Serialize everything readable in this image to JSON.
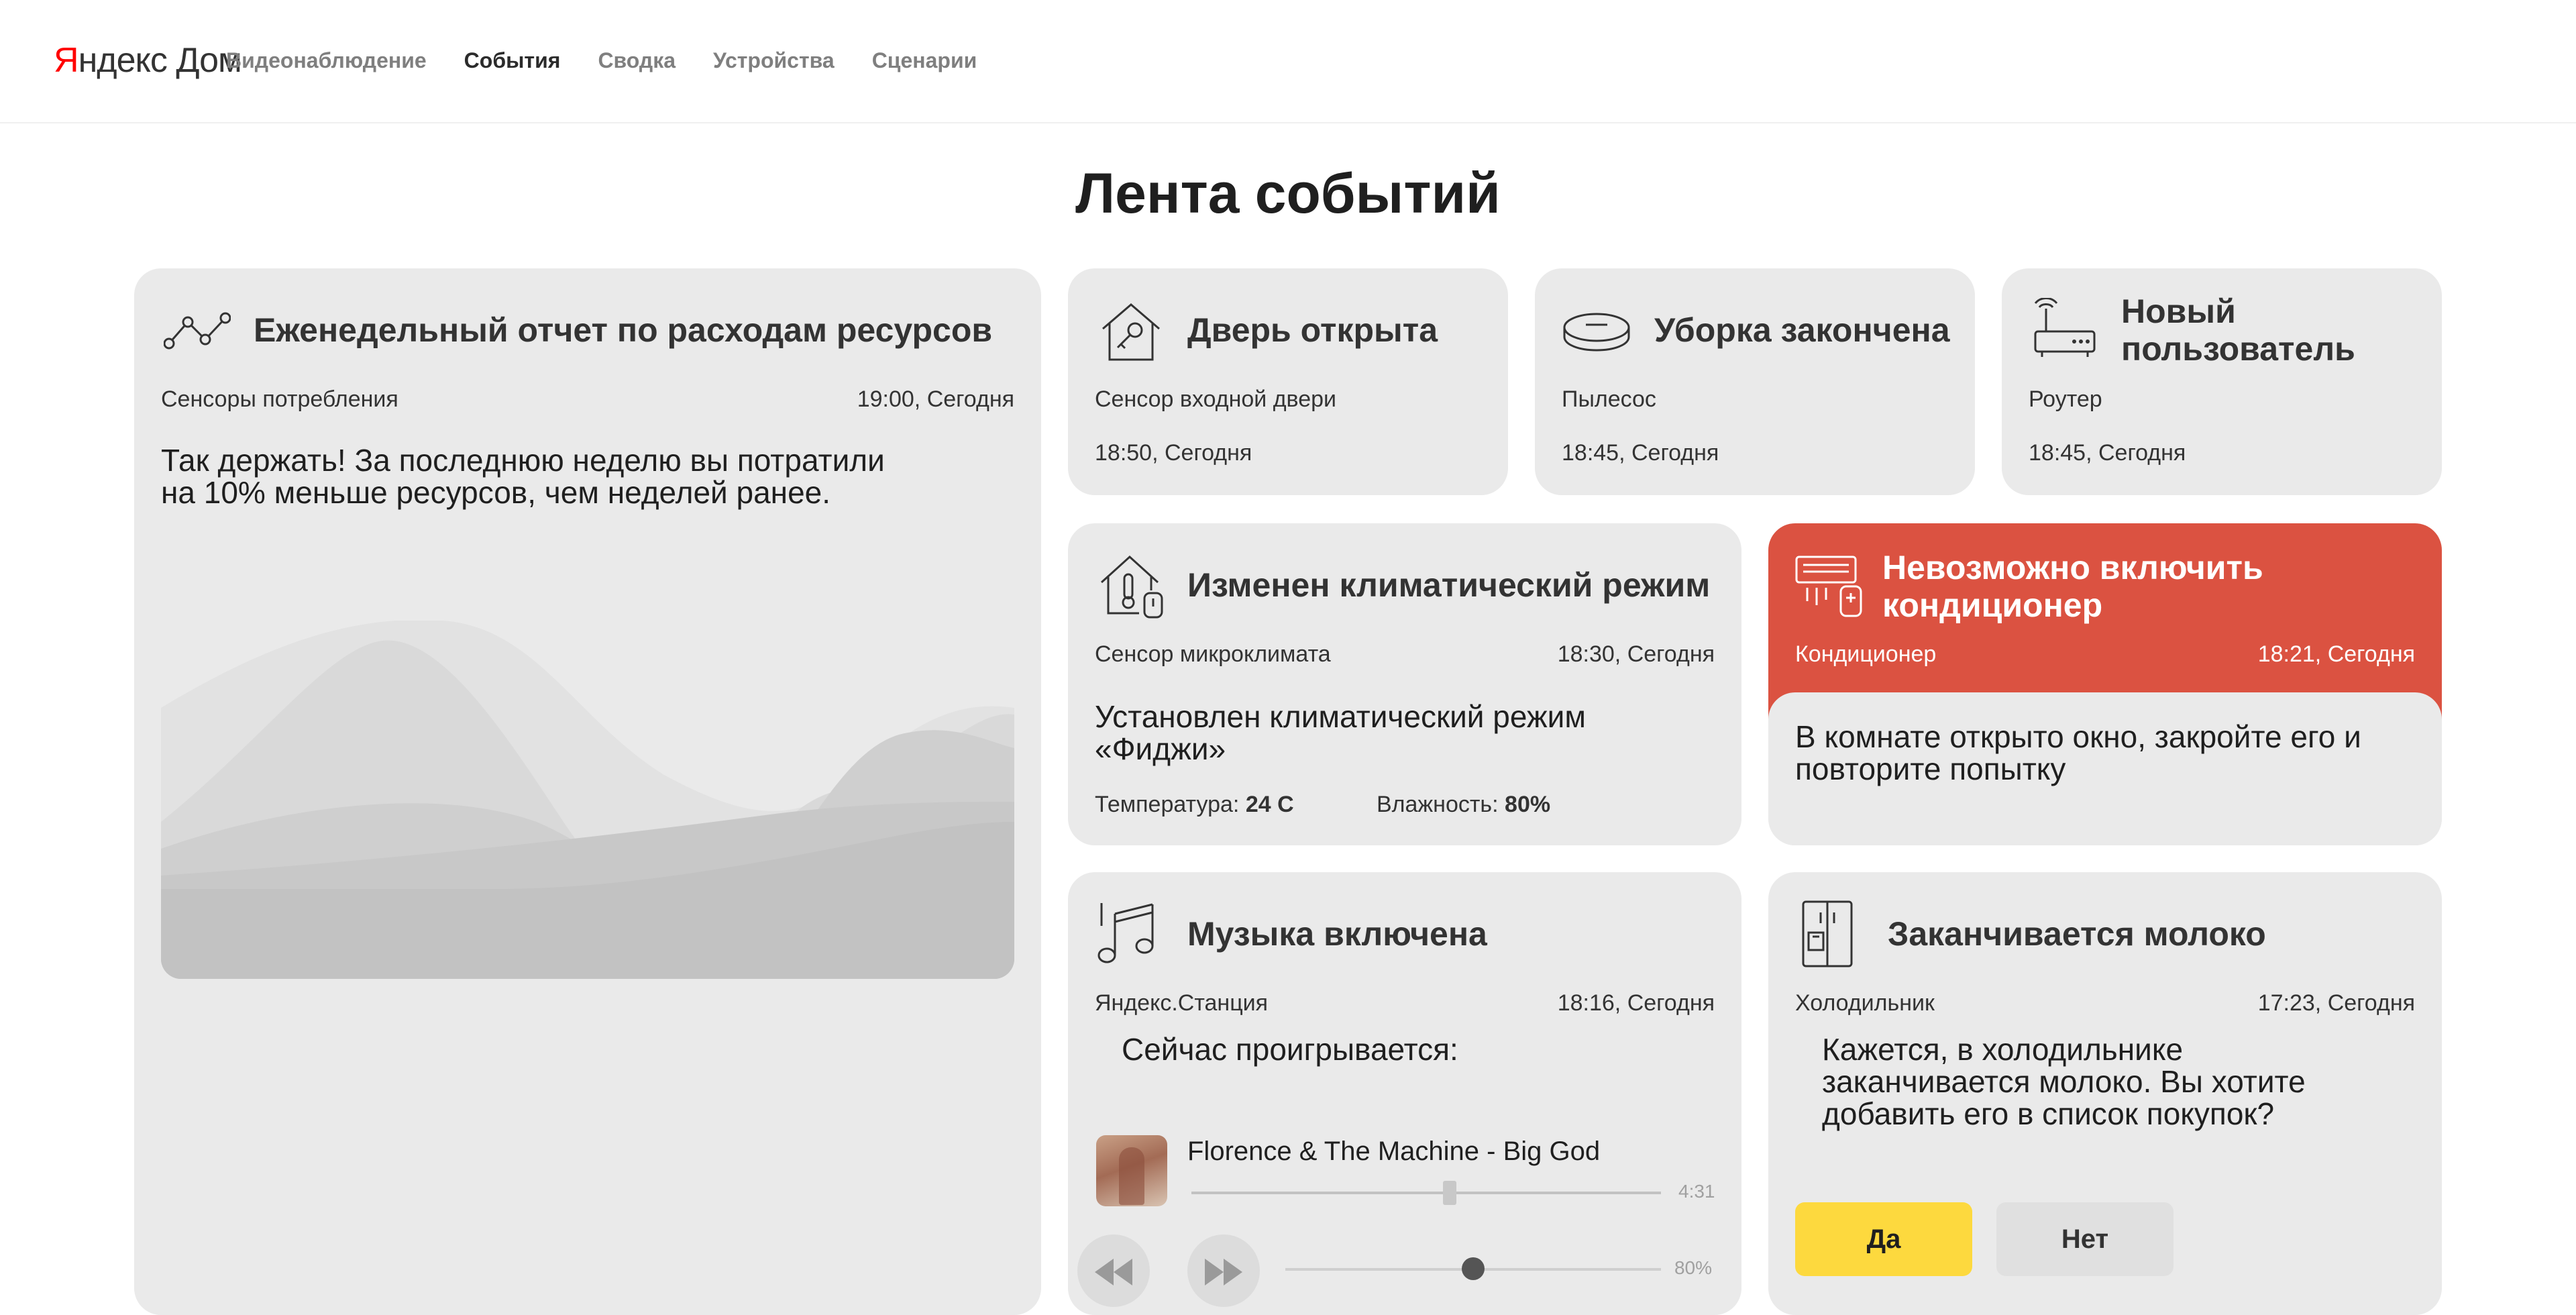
{
  "header": {
    "logo_y": "Я",
    "logo_rest": "ндекс Дом",
    "nav": [
      "Видеонаблюдение",
      "События",
      "Сводка",
      "Устройства",
      "Сценарии"
    ],
    "active_nav": "События"
  },
  "page_title": "Лента событий",
  "cards": {
    "weekly": {
      "icon": "graph-icon",
      "title": "Еженедельный отчет по расходам ресурсов",
      "source": "Сенсоры потребления",
      "time": "19:00, Сегодня",
      "text_line1": "Так держать! За последнюю неделю вы потратили",
      "text_line2": "на 10% меньше ресурсов, чем неделей ранее."
    },
    "door": {
      "icon": "house-key-icon",
      "title": "Дверь открыта",
      "source": "Сенсор входной двери",
      "time": "18:50, Сегодня"
    },
    "cleaning": {
      "icon": "robot-vacuum-icon",
      "title": "Уборка закончена",
      "source": "Пылесос",
      "time": "18:45, Сегодня"
    },
    "newuser": {
      "icon": "router-icon",
      "title_line1": "Новый",
      "title_line2": "пользователь",
      "source": "Роутер",
      "time": "18:45, Сегодня"
    },
    "climate": {
      "icon": "house-thermometer-icon",
      "title": "Изменен климатический режим",
      "source": "Сенсор микроклимата",
      "time": "18:30, Сегодня",
      "text_line1": "Установлен климатический режим",
      "text_line2": "«Фиджи»",
      "temp_label": "Температура:",
      "temp_value": "24 С",
      "humidity_label": "Влажность:",
      "humidity_value": "80%"
    },
    "ac": {
      "icon": "air-conditioner-icon",
      "title_line1": "Невозможно включить",
      "title_line2": "кондиционер",
      "source": "Кондиционер",
      "time": "18:21, Сегодня",
      "text_line1": "В комнате открыто окно, закройте его и",
      "text_line2": "повторите попытку",
      "accent": "#db5241"
    },
    "music": {
      "icon": "music-note-icon",
      "title": "Музыка включена",
      "source": "Яндекс.Станция",
      "time": "18:16, Сегодня",
      "playing_label": "Сейчас проигрывается:",
      "track": "Florence & The Machine - Big God",
      "duration": "4:31",
      "progress": 0.55,
      "volume": "80%",
      "volume_level": 0.5
    },
    "milk": {
      "icon": "fridge-icon",
      "title": "Заканчивается молоко",
      "source": "Холодильник",
      "time": "17:23, Сегодня",
      "text_line1": "Кажется, в холодильнике",
      "text_line2": "заканчивается молоко. Вы хотите",
      "text_line3": "добавить его в список покупок?",
      "yes": "Да",
      "no": "Нет",
      "yes_color": "#fdd93e"
    }
  }
}
